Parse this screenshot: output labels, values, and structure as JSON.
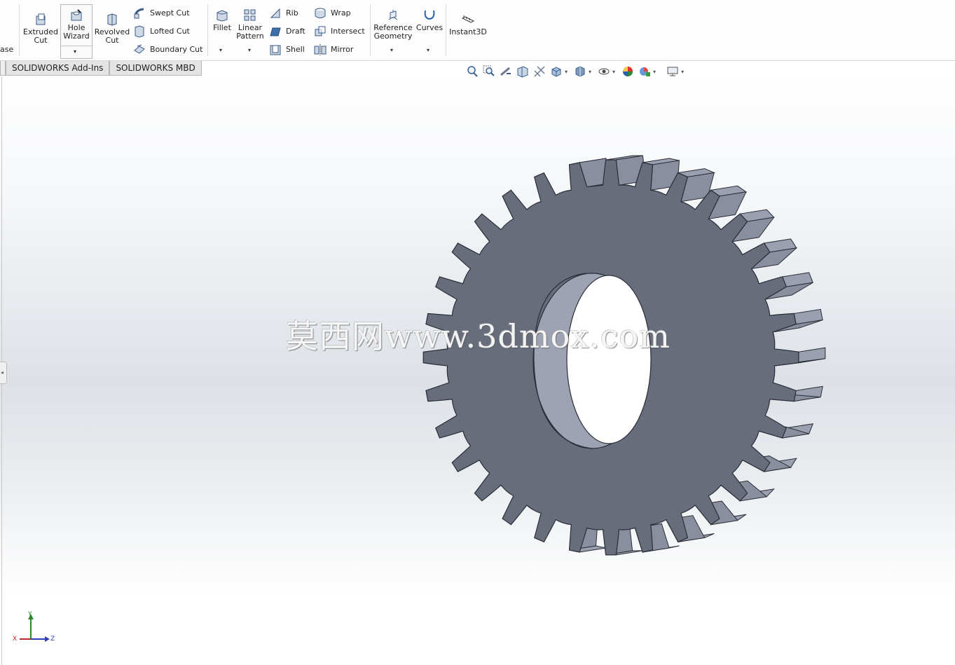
{
  "ribbon": {
    "partial_left_label": "ase",
    "extruded_cut": "Extruded\nCut",
    "hole_wizard": "Hole\nWizard",
    "revolved_cut": "Revolved\nCut",
    "swept_cut": "Swept Cut",
    "lofted_cut": "Lofted Cut",
    "boundary_cut": "Boundary Cut",
    "fillet": "Fillet",
    "linear_pattern": "Linear\nPattern",
    "rib": "Rib",
    "draft": "Draft",
    "shell": "Shell",
    "wrap": "Wrap",
    "intersect": "Intersect",
    "mirror": "Mirror",
    "reference_geometry": "Reference\nGeometry",
    "curves": "Curves",
    "instant3d": "Instant3D",
    "dropdown_glyph": "▾"
  },
  "tabs": [
    {
      "label": "SOLIDWORKS Add-Ins"
    },
    {
      "label": "SOLIDWORKS MBD"
    }
  ],
  "heads_up_toolbar": {
    "icons": [
      "zoom-to-fit-icon",
      "zoom-to-area-icon",
      "previous-view-icon",
      "section-view-icon",
      "dynamic-annotation-icon",
      "view-orientation-icon",
      "display-style-icon",
      "hide-show-items-icon",
      "edit-appearance-icon",
      "apply-scene-icon",
      "view-settings-icon"
    ]
  },
  "viewport": {
    "gear_teeth": 32,
    "gear_face_color": "#686d7c",
    "gear_side_color": "#9ba0b0",
    "watermark": "莫西网www.3dmox.com"
  },
  "triad": {
    "x": "X",
    "y": "Y",
    "z": "Z"
  },
  "colors": {
    "axis_x": "#c0262d",
    "axis_y": "#2c8a2c",
    "axis_z": "#2b3fb0"
  }
}
